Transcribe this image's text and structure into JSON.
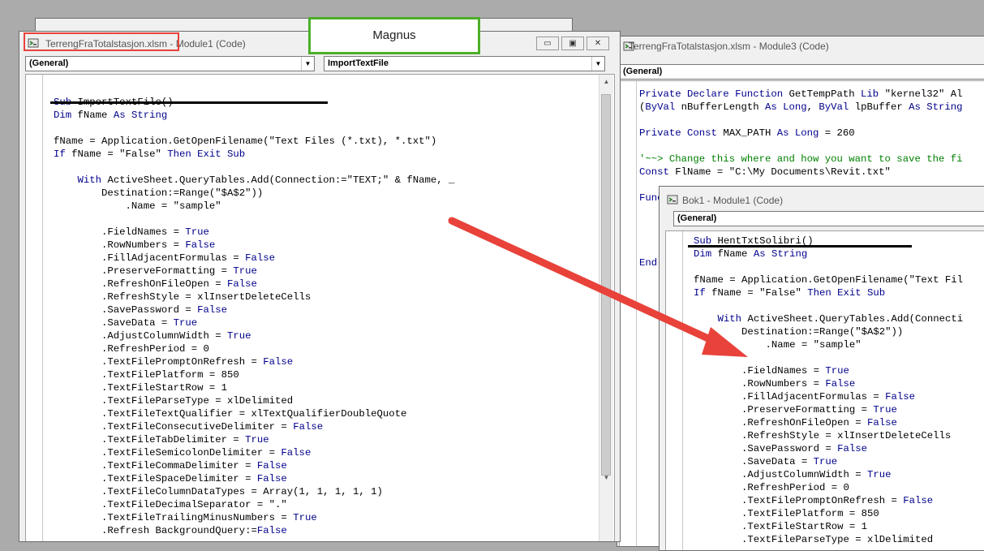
{
  "background_window": {
    "title": "TerrengFraTotalstasjon.xlsm - Module3 (Code)",
    "combo_general": "(General)",
    "code_lines": [
      [
        [
          "Private Declare Function ",
          "kw"
        ],
        [
          "GetTempPath ",
          ""
        ],
        [
          "Lib ",
          "kw"
        ],
        [
          "\"kernel32\" Al",
          ""
        ]
      ],
      [
        [
          "(",
          ""
        ],
        [
          "ByVal ",
          "kw"
        ],
        [
          "nBufferLength ",
          ""
        ],
        [
          "As Long",
          "kw"
        ],
        [
          ", ",
          ""
        ],
        [
          "ByVal ",
          "kw"
        ],
        [
          "lpBuffer ",
          ""
        ],
        [
          "As String",
          "kw"
        ]
      ],
      [],
      [
        [
          "Private Const ",
          "kw"
        ],
        [
          "MAX_PATH ",
          ""
        ],
        [
          "As Long ",
          "kw"
        ],
        [
          "= 260",
          ""
        ]
      ],
      [],
      [
        [
          "'~~> Change this where and how you want to save the fi",
          "cm"
        ]
      ],
      [
        [
          "Const ",
          "kw"
        ],
        [
          "FlName = \"C:\\My Documents\\Revit.txt\"",
          ""
        ]
      ],
      [],
      [
        [
          "Func",
          "kw"
        ]
      ],
      [],
      [],
      [],
      [],
      [
        [
          "End",
          "kw"
        ]
      ]
    ]
  },
  "main_window": {
    "title": "TerrengFraTotalstasjon.xlsm - Module1 (Code)",
    "combo_general": "(General)",
    "combo_procedure": "ImportTextFile",
    "buttons": {
      "minimize": "▭",
      "restore": "▣",
      "close": "✕"
    },
    "code_lines": [
      [],
      [
        [
          "Sub ",
          "kw"
        ],
        [
          "ImportTextFile()",
          ""
        ]
      ],
      [
        [
          "Dim ",
          "kw"
        ],
        [
          "fName ",
          ""
        ],
        [
          "As String",
          "kw"
        ]
      ],
      [],
      [
        [
          "fName = Application.GetOpenFilename(\"Text Files (*.txt), *.txt\")",
          ""
        ]
      ],
      [
        [
          "If ",
          "kw"
        ],
        [
          "fName = \"False\" ",
          ""
        ],
        [
          "Then Exit Sub",
          "kw"
        ]
      ],
      [],
      [
        [
          "    ",
          ""
        ],
        [
          "With ",
          "kw"
        ],
        [
          "ActiveSheet.QueryTables.Add(Connection:=\"TEXT;\" & fName, _",
          ""
        ]
      ],
      [
        [
          "        Destination:=Range(\"$A$2\"))",
          ""
        ]
      ],
      [
        [
          "            .Name = \"sample\"",
          ""
        ]
      ],
      [],
      [
        [
          "        .FieldNames = ",
          ""
        ],
        [
          "True",
          "kw"
        ]
      ],
      [
        [
          "        .RowNumbers = ",
          ""
        ],
        [
          "False",
          "kw"
        ]
      ],
      [
        [
          "        .FillAdjacentFormulas = ",
          ""
        ],
        [
          "False",
          "kw"
        ]
      ],
      [
        [
          "        .PreserveFormatting = ",
          ""
        ],
        [
          "True",
          "kw"
        ]
      ],
      [
        [
          "        .RefreshOnFileOpen = ",
          ""
        ],
        [
          "False",
          "kw"
        ]
      ],
      [
        [
          "        .RefreshStyle = xlInsertDeleteCells",
          ""
        ]
      ],
      [
        [
          "        .SavePassword = ",
          ""
        ],
        [
          "False",
          "kw"
        ]
      ],
      [
        [
          "        .SaveData = ",
          ""
        ],
        [
          "True",
          "kw"
        ]
      ],
      [
        [
          "        .AdjustColumnWidth = ",
          ""
        ],
        [
          "True",
          "kw"
        ]
      ],
      [
        [
          "        .RefreshPeriod = 0",
          ""
        ]
      ],
      [
        [
          "        .TextFilePromptOnRefresh = ",
          ""
        ],
        [
          "False",
          "kw"
        ]
      ],
      [
        [
          "        .TextFilePlatform = 850",
          ""
        ]
      ],
      [
        [
          "        .TextFileStartRow = 1",
          ""
        ]
      ],
      [
        [
          "        .TextFileParseType = xlDelimited",
          ""
        ]
      ],
      [
        [
          "        .TextFileTextQualifier = xlTextQualifierDoubleQuote",
          ""
        ]
      ],
      [
        [
          "        .TextFileConsecutiveDelimiter = ",
          ""
        ],
        [
          "False",
          "kw"
        ]
      ],
      [
        [
          "        .TextFileTabDelimiter = ",
          ""
        ],
        [
          "True",
          "kw"
        ]
      ],
      [
        [
          "        .TextFileSemicolonDelimiter = ",
          ""
        ],
        [
          "False",
          "kw"
        ]
      ],
      [
        [
          "        .TextFileCommaDelimiter = ",
          ""
        ],
        [
          "False",
          "kw"
        ]
      ],
      [
        [
          "        .TextFileSpaceDelimiter = ",
          ""
        ],
        [
          "False",
          "kw"
        ]
      ],
      [
        [
          "        .TextFileColumnDataTypes = Array(1, 1, 1, 1, 1)",
          ""
        ]
      ],
      [
        [
          "        .TextFileDecimalSeparator = \".\"",
          ""
        ]
      ],
      [
        [
          "        .TextFileTrailingMinusNumbers = ",
          ""
        ],
        [
          "True",
          "kw"
        ]
      ],
      [
        [
          "        .Refresh BackgroundQuery:=",
          ""
        ],
        [
          "False",
          "kw"
        ]
      ]
    ]
  },
  "front_window": {
    "title": "Bok1 - Module1 (Code)",
    "combo_general": "(General)",
    "code_lines": [
      [
        [
          "Sub ",
          "kw"
        ],
        [
          "HentTxtSolibri()",
          ""
        ]
      ],
      [
        [
          "Dim ",
          "kw"
        ],
        [
          "fName ",
          ""
        ],
        [
          "As String",
          "kw"
        ]
      ],
      [],
      [
        [
          "fName = Application.GetOpenFilename(\"Text Fil",
          ""
        ]
      ],
      [
        [
          "If ",
          "kw"
        ],
        [
          "fName = \"False\" ",
          ""
        ],
        [
          "Then Exit Sub",
          "kw"
        ]
      ],
      [],
      [
        [
          "    ",
          ""
        ],
        [
          "With ",
          "kw"
        ],
        [
          "ActiveSheet.QueryTables.Add(Connecti",
          ""
        ]
      ],
      [
        [
          "        Destination:=Range(\"$A$2\"))",
          ""
        ]
      ],
      [
        [
          "            .Name = \"sample\"",
          ""
        ]
      ],
      [],
      [
        [
          "        .FieldNames = ",
          ""
        ],
        [
          "True",
          "kw"
        ]
      ],
      [
        [
          "        .RowNumbers = ",
          ""
        ],
        [
          "False",
          "kw"
        ]
      ],
      [
        [
          "        .FillAdjacentFormulas = ",
          ""
        ],
        [
          "False",
          "kw"
        ]
      ],
      [
        [
          "        .PreserveFormatting = ",
          ""
        ],
        [
          "True",
          "kw"
        ]
      ],
      [
        [
          "        .RefreshOnFileOpen = ",
          ""
        ],
        [
          "False",
          "kw"
        ]
      ],
      [
        [
          "        .RefreshStyle = xlInsertDeleteCells",
          ""
        ]
      ],
      [
        [
          "        .SavePassword = ",
          ""
        ],
        [
          "False",
          "kw"
        ]
      ],
      [
        [
          "        .SaveData = ",
          ""
        ],
        [
          "True",
          "kw"
        ]
      ],
      [
        [
          "        .AdjustColumnWidth = ",
          ""
        ],
        [
          "True",
          "kw"
        ]
      ],
      [
        [
          "        .RefreshPeriod = 0",
          ""
        ]
      ],
      [
        [
          "        .TextFilePromptOnRefresh = ",
          ""
        ],
        [
          "False",
          "kw"
        ]
      ],
      [
        [
          "        .TextFilePlatform = 850",
          ""
        ]
      ],
      [
        [
          "        .TextFileStartRow = 1",
          ""
        ]
      ],
      [
        [
          "        .TextFileParseType = xlDelimited",
          ""
        ]
      ]
    ]
  },
  "annotation": {
    "name_box": "Magnus"
  },
  "colors": {
    "keyword": "#00008b",
    "comment": "#008000",
    "arrow": "#e8423b",
    "highlight_box": "#e8423b",
    "name_box_border": "#4caf29"
  }
}
